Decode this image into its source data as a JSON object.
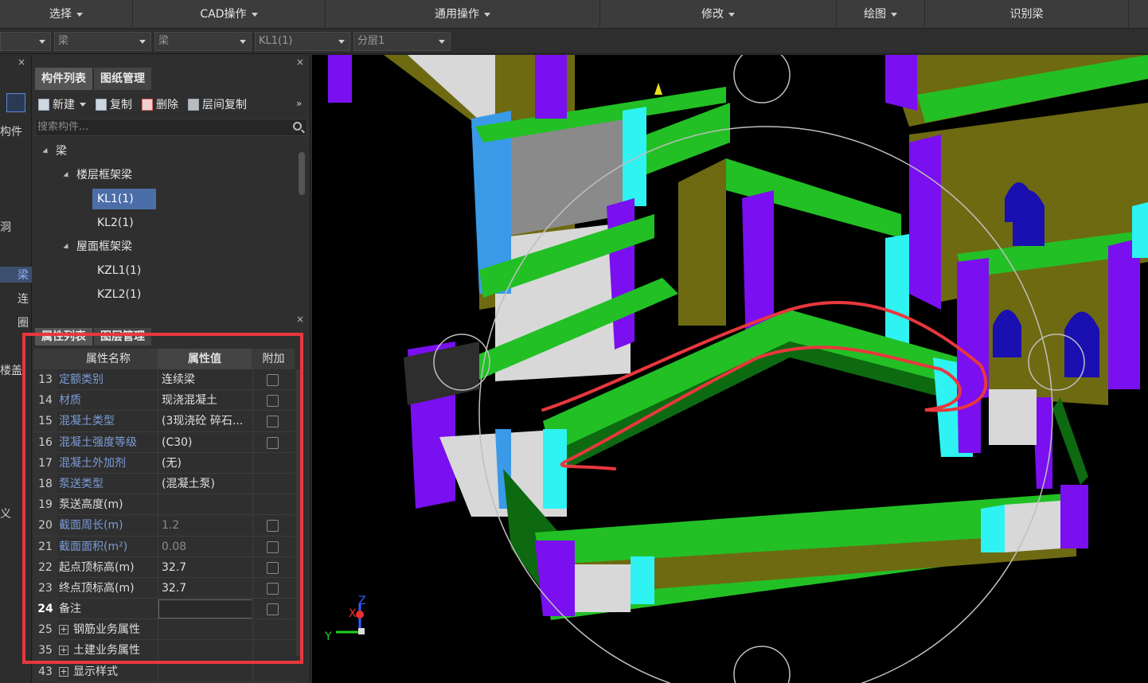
{
  "menubar": {
    "items": [
      "选择",
      "CAD操作",
      "通用操作",
      "修改",
      "绘图",
      "识别梁"
    ]
  },
  "selectors": {
    "floor": "",
    "type": "梁",
    "subtype": "梁",
    "component": "KL1(1)",
    "layer": "分层1"
  },
  "left_strip": {
    "labels": [
      "构件",
      "洞",
      "梁",
      "连",
      "圈",
      "楼盖",
      "义"
    ]
  },
  "comp_panel": {
    "tabs": [
      "构件列表",
      "图纸管理"
    ],
    "actions": [
      "新建",
      "复制",
      "删除",
      "层间复制"
    ],
    "search_placeholder": "搜索构件...",
    "tree": {
      "root": "梁",
      "group1": "楼层框架梁",
      "group1_items": [
        "KL1(1)",
        "KL2(1)"
      ],
      "group2": "屋面框架梁",
      "group2_items": [
        "KZL1(1)",
        "KZL2(1)"
      ]
    }
  },
  "prop_panel": {
    "tabs": [
      "属性列表",
      "图层管理"
    ],
    "headers": {
      "name": "属性名称",
      "value": "属性值",
      "extra": "附加"
    },
    "rows": [
      {
        "num": "13",
        "name": "定额类别",
        "value": "连续梁",
        "linked": true,
        "check": true
      },
      {
        "num": "14",
        "name": "材质",
        "value": "现浇混凝土",
        "linked": true,
        "check": true
      },
      {
        "num": "15",
        "name": "混凝土类型",
        "value": "(3现浇砼 碎石...",
        "linked": true,
        "check": true
      },
      {
        "num": "16",
        "name": "混凝土强度等级",
        "value": "(C30)",
        "linked": true,
        "check": true
      },
      {
        "num": "17",
        "name": "混凝土外加剂",
        "value": "(无)",
        "linked": true,
        "check": false
      },
      {
        "num": "18",
        "name": "泵送类型",
        "value": "(混凝土泵)",
        "linked": true,
        "check": false
      },
      {
        "num": "19",
        "name": "泵送高度(m)",
        "value": "",
        "linked": false,
        "check": false
      },
      {
        "num": "20",
        "name": "截面周长(m)",
        "value": "1.2",
        "linked": true,
        "check": true,
        "gray": true
      },
      {
        "num": "21",
        "name": "截面面积(m²)",
        "value": "0.08",
        "linked": true,
        "check": true,
        "gray": true
      },
      {
        "num": "22",
        "name": "起点顶标高(m)",
        "value": "32.7",
        "linked": false,
        "check": true
      },
      {
        "num": "23",
        "name": "终点顶标高(m)",
        "value": "32.7",
        "linked": false,
        "check": true
      },
      {
        "num": "24",
        "name": "备注",
        "value": "",
        "linked": false,
        "check": true,
        "input": true
      },
      {
        "num": "25",
        "name": "钢筋业务属性",
        "value": "",
        "linked": false,
        "check": false,
        "expand": true
      },
      {
        "num": "35",
        "name": "土建业务属性",
        "value": "",
        "linked": false,
        "check": false,
        "expand": true
      },
      {
        "num": "43",
        "name": "显示样式",
        "value": "",
        "linked": false,
        "check": false,
        "expand": true
      }
    ]
  },
  "viewport": {
    "axis_labels": {
      "x": "X",
      "y": "Y",
      "z": "Z"
    }
  },
  "colors": {
    "beam_green": "#22c025",
    "wall_olive": "#6e6a12",
    "column_purple": "#7a0ff0",
    "cyan": "#2ff2f2",
    "highlight_red": "#e8383d",
    "selected_row": "#4c6ea8"
  }
}
